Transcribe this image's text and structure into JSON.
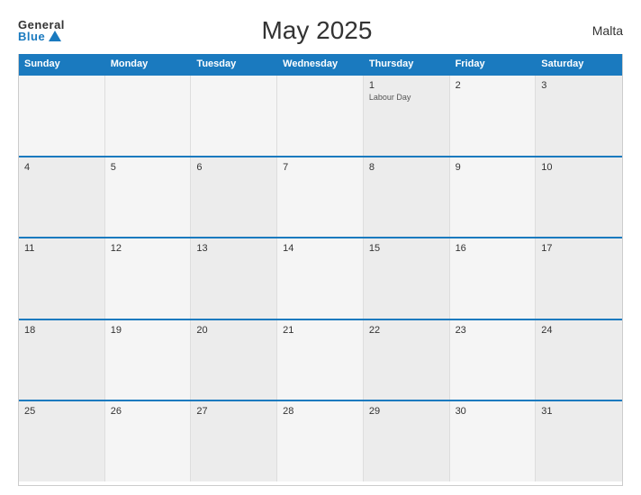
{
  "header": {
    "logo_general": "General",
    "logo_blue": "Blue",
    "title": "May 2025",
    "country": "Malta"
  },
  "calendar": {
    "days_of_week": [
      "Sunday",
      "Monday",
      "Tuesday",
      "Wednesday",
      "Thursday",
      "Friday",
      "Saturday"
    ],
    "weeks": [
      [
        {
          "day": "",
          "event": ""
        },
        {
          "day": "",
          "event": ""
        },
        {
          "day": "",
          "event": ""
        },
        {
          "day": "",
          "event": ""
        },
        {
          "day": "1",
          "event": "Labour Day"
        },
        {
          "day": "2",
          "event": ""
        },
        {
          "day": "3",
          "event": ""
        }
      ],
      [
        {
          "day": "4",
          "event": ""
        },
        {
          "day": "5",
          "event": ""
        },
        {
          "day": "6",
          "event": ""
        },
        {
          "day": "7",
          "event": ""
        },
        {
          "day": "8",
          "event": ""
        },
        {
          "day": "9",
          "event": ""
        },
        {
          "day": "10",
          "event": ""
        }
      ],
      [
        {
          "day": "11",
          "event": ""
        },
        {
          "day": "12",
          "event": ""
        },
        {
          "day": "13",
          "event": ""
        },
        {
          "day": "14",
          "event": ""
        },
        {
          "day": "15",
          "event": ""
        },
        {
          "day": "16",
          "event": ""
        },
        {
          "day": "17",
          "event": ""
        }
      ],
      [
        {
          "day": "18",
          "event": ""
        },
        {
          "day": "19",
          "event": ""
        },
        {
          "day": "20",
          "event": ""
        },
        {
          "day": "21",
          "event": ""
        },
        {
          "day": "22",
          "event": ""
        },
        {
          "day": "23",
          "event": ""
        },
        {
          "day": "24",
          "event": ""
        }
      ],
      [
        {
          "day": "25",
          "event": ""
        },
        {
          "day": "26",
          "event": ""
        },
        {
          "day": "27",
          "event": ""
        },
        {
          "day": "28",
          "event": ""
        },
        {
          "day": "29",
          "event": ""
        },
        {
          "day": "30",
          "event": ""
        },
        {
          "day": "31",
          "event": ""
        }
      ]
    ]
  }
}
